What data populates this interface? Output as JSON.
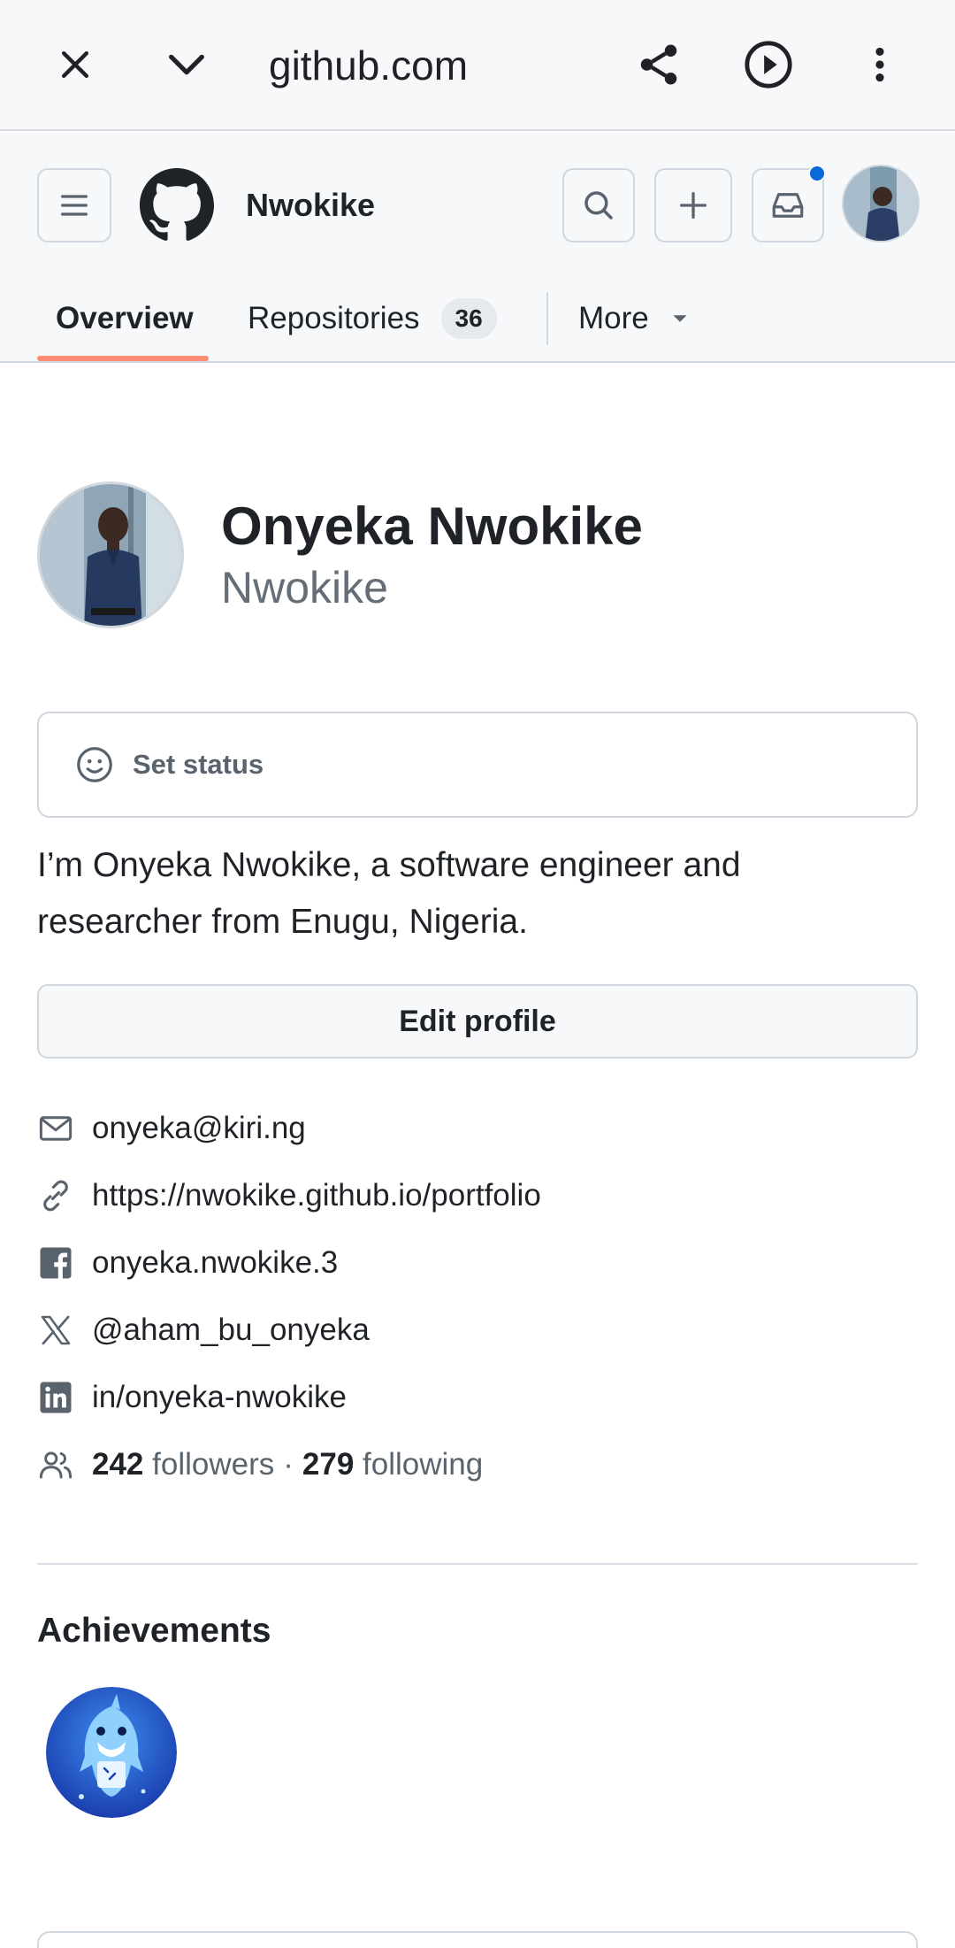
{
  "browser": {
    "url": "github.com"
  },
  "header": {
    "username": "Nwokike",
    "has_notification": true
  },
  "tabs": [
    {
      "label": "Overview",
      "active": true
    },
    {
      "label": "Repositories",
      "count": "36"
    },
    {
      "label": "More"
    }
  ],
  "profile": {
    "name": "Onyeka Nwokike",
    "login": "Nwokike",
    "status_label": "Set status",
    "bio": "I’m Onyeka Nwokike, a software engineer and researcher from Enugu, Nigeria.",
    "edit_label": "Edit profile",
    "email": "onyeka@kiri.ng",
    "website": "https://nwokike.github.io/portfolio",
    "facebook": "onyeka.nwokike.3",
    "x_handle": "@aham_bu_onyeka",
    "linkedin": "in/onyeka-nwokike",
    "followers_count": "242",
    "followers_label": "followers",
    "separator": "·",
    "following_count": "279",
    "following_label": "following"
  },
  "achievements": {
    "title": "Achievements",
    "badges": [
      "shark-achievement-badge"
    ]
  },
  "colors": {
    "tab_underline": "#fd8c73",
    "notification_dot": "#0969da",
    "header_bg": "#f6f8fa"
  }
}
